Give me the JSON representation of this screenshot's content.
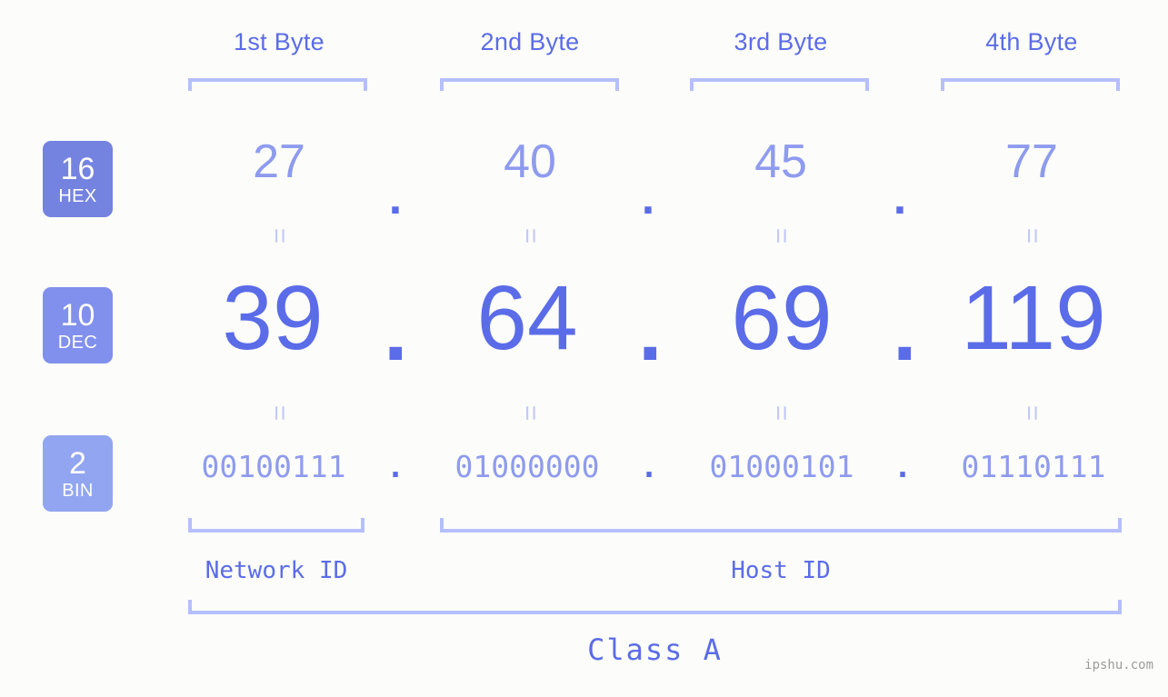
{
  "meta": {
    "background_color": "#fcfdfa",
    "accent_color": "#5b6ce8",
    "accent_light_color": "#8e9bee",
    "bracket_color": "#b5bffb",
    "watermark": "ipshu.com"
  },
  "headers": [
    {
      "label": "1st Byte"
    },
    {
      "label": "2nd Byte"
    },
    {
      "label": "3rd Byte"
    },
    {
      "label": "4th Byte"
    }
  ],
  "bases": [
    {
      "number": "16",
      "name": "HEX",
      "color": "#7583e0"
    },
    {
      "number": "10",
      "name": "DEC",
      "color": "#8190ec"
    },
    {
      "number": "2",
      "name": "BIN",
      "color": "#92a5f0"
    }
  ],
  "separator": ".",
  "equals_mark": "=",
  "rows": {
    "hex": {
      "base": "16",
      "label": "HEX",
      "values": [
        "27",
        "40",
        "45",
        "77"
      ]
    },
    "dec": {
      "base": "10",
      "label": "DEC",
      "values": [
        "39",
        "64",
        "69",
        "119"
      ]
    },
    "bin": {
      "base": "2",
      "label": "BIN",
      "values": [
        "00100111",
        "01000000",
        "01000101",
        "01110111"
      ]
    }
  },
  "address": {
    "hex": "27.40.45.77",
    "dec": "39.64.69.119",
    "bin": "00100111.01000000.01000101.01110111"
  },
  "segments": {
    "network_id": "Network ID",
    "host_id": "Host ID",
    "class": "Class A"
  }
}
